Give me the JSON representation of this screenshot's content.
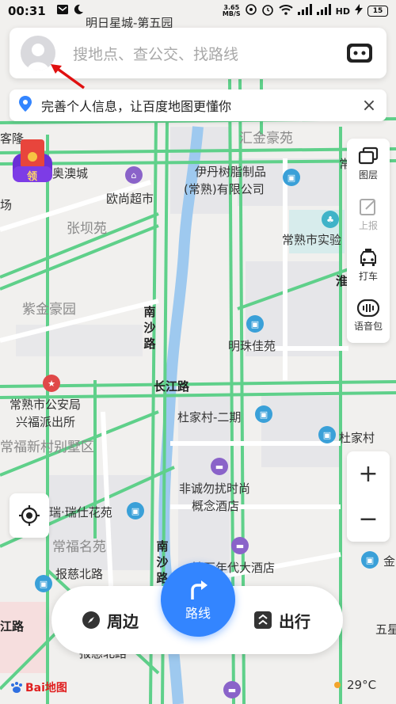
{
  "status_bar": {
    "time": "00:31",
    "net_speed_value": "3.65",
    "net_speed_unit": "MB/S",
    "battery": "15"
  },
  "search": {
    "placeholder": "搜地点、查公交、找路线"
  },
  "notice": {
    "text": "完善个人信息，让百度地图更懂你"
  },
  "tools": [
    {
      "label": "图层",
      "icon": "layers-icon"
    },
    {
      "label": "上报",
      "icon": "report-icon"
    },
    {
      "label": "打车",
      "icon": "taxi-icon"
    },
    {
      "label": "语音包",
      "icon": "voice-pack-icon"
    }
  ],
  "zoom": {
    "in": "+",
    "out": "−"
  },
  "bottom_bar": {
    "nearby_label": "周边",
    "route_label": "路线",
    "travel_label": "出行"
  },
  "map_labels": {
    "top_partial": "明日星城-第五园",
    "huijin": "汇金豪苑",
    "yidan": "伊丹树脂制品",
    "yidan2": "(常熟)有限公司",
    "ouaocheng": "奥澳城",
    "oushang": "欧尚超市",
    "zhangba": "张坝苑",
    "changshu_shiyan": "常熟市实验",
    "zijin": "紫金豪园",
    "nansha1": "南沙路",
    "mingzhu": "明珠佳苑",
    "changjiang": "长江路",
    "gongan1": "常熟市公安局",
    "gongan2": "兴福派出所",
    "changfu_villa": "常福新村别墅区",
    "dujiacun1": "杜家村-二期",
    "dujiacun2": "杜家村",
    "feicheng1": "非诚勿扰时尚",
    "feicheng2": "概念酒店",
    "ruishi": "瑞·瑞仕花苑",
    "changfu_mingyuan": "常福名苑",
    "nansha2": "南沙路",
    "baoci": "报慈北路",
    "zuanshi": "钻石年代大酒店",
    "jiang_road": "江路",
    "wuxing": "五星",
    "kelong": "客隆",
    "chang_edge": "常",
    "chang_edge2": "场",
    "huai": "淮",
    "jin": "金",
    "baoci2": "报慈北路",
    "ling": "领"
  },
  "logo": {
    "text": "Bai地图"
  },
  "weather": {
    "temp": "29°C"
  },
  "colors": {
    "accent": "#3385ff",
    "road_green": "#5fd08a",
    "river": "#9ec9ef",
    "map_bg": "#f1f0ee"
  }
}
